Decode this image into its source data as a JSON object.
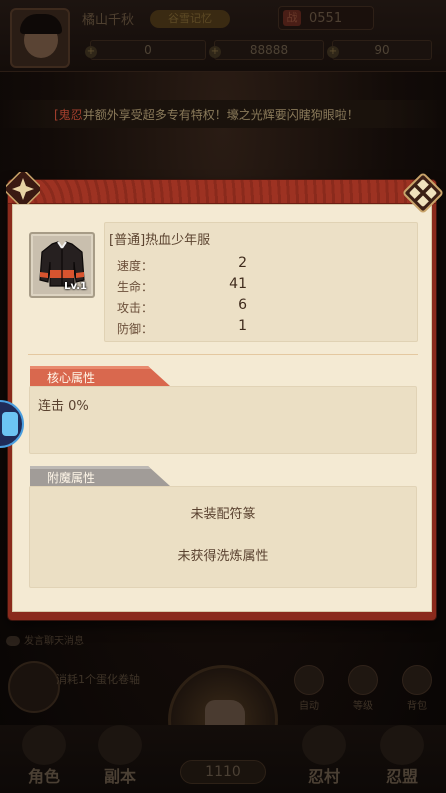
{
  "background": {
    "player_name": "橘山千秋",
    "power_badge": "谷雪记忆",
    "power_icon": "战",
    "power_value": "0551",
    "resources": [
      {
        "name": "copper",
        "value": "0"
      },
      {
        "name": "gold",
        "value": "88888"
      },
      {
        "name": "gem",
        "value": "90"
      }
    ],
    "ticker": {
      "tag": "[鬼忍",
      "text": "并额外享受超多专有特权！壕之光辉要闪瞎狗眼啦！"
    },
    "chat_placeholder": "发言聊天消息",
    "quest": {
      "text": "消耗1个蛋化卷轴"
    },
    "side_buttons": [
      {
        "id": "auto",
        "label": "自动"
      },
      {
        "id": "level",
        "label": "等级"
      },
      {
        "id": "bag",
        "label": "背包"
      }
    ],
    "nav": [
      {
        "id": "character",
        "label": "角色"
      },
      {
        "id": "dungeon",
        "label": "副本"
      },
      {
        "id": "ninja-village",
        "label": "忍村"
      },
      {
        "id": "alliance",
        "label": "忍盟"
      }
    ],
    "battle_count": "1110"
  },
  "modal": {
    "item": {
      "level": "Lv.1",
      "title": "[普通]热血少年服",
      "stats": [
        {
          "label": "速度：",
          "value": "2"
        },
        {
          "label": "生命：",
          "value": "41"
        },
        {
          "label": "攻击：",
          "value": "6"
        },
        {
          "label": "防御：",
          "value": "1"
        }
      ]
    },
    "core_section": {
      "title": "核心属性",
      "text": "连击 0%"
    },
    "enchant_section": {
      "title": "附魔属性",
      "line1": "未装配符篆",
      "line2": "未获得洗炼属性"
    }
  },
  "colors": {
    "frame": "#8a2a1c",
    "parchment": "#f4ead3",
    "core_tab": "#d9684e",
    "enchant_tab": "#a19c98"
  }
}
